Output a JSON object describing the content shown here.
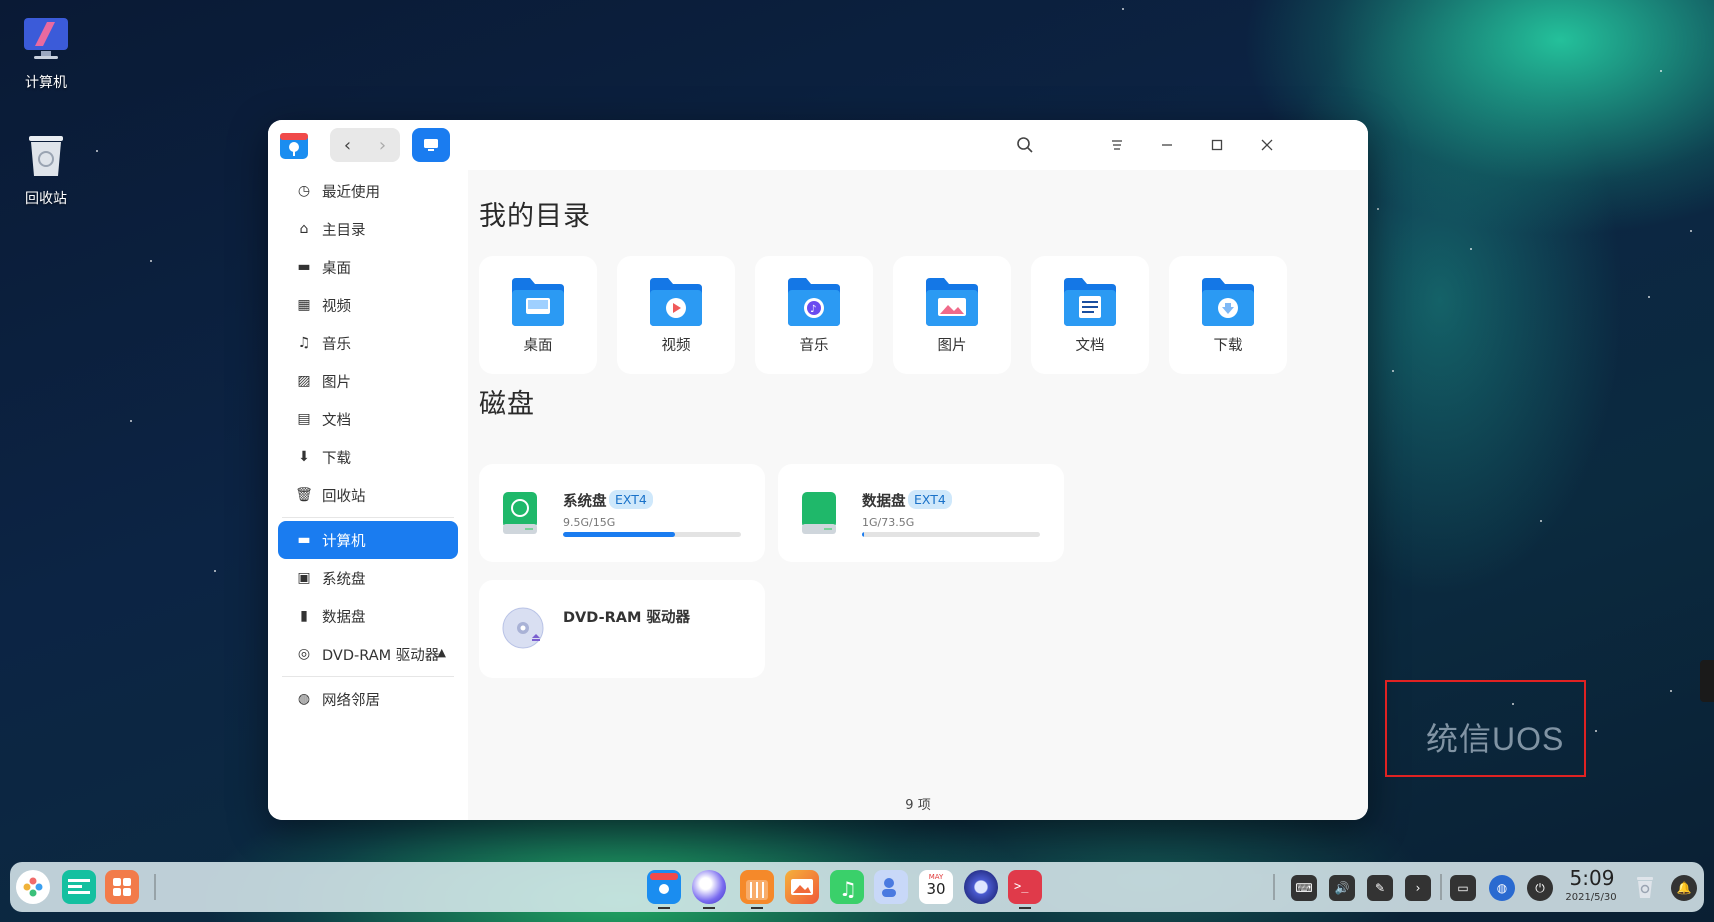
{
  "desktop": {
    "icons": [
      {
        "label": "计算机"
      },
      {
        "label": "回收站"
      }
    ]
  },
  "window": {
    "sidebar": {
      "items": [
        {
          "label": "最近使用",
          "icon": "clock-icon"
        },
        {
          "label": "主目录",
          "icon": "home-icon"
        },
        {
          "label": "桌面",
          "icon": "desktop-icon"
        },
        {
          "label": "视频",
          "icon": "video-icon"
        },
        {
          "label": "音乐",
          "icon": "music-icon"
        },
        {
          "label": "图片",
          "icon": "picture-icon"
        },
        {
          "label": "文档",
          "icon": "document-icon"
        },
        {
          "label": "下载",
          "icon": "download-icon"
        },
        {
          "label": "回收站",
          "icon": "trash-icon"
        },
        {
          "label": "计算机",
          "icon": "computer-icon",
          "active": true
        },
        {
          "label": "系统盘",
          "icon": "disk-icon"
        },
        {
          "label": "数据盘",
          "icon": "disk-icon"
        },
        {
          "label": "DVD-RAM 驱动器",
          "icon": "disc-icon"
        },
        {
          "label": "网络邻居",
          "icon": "network-icon"
        }
      ]
    },
    "content": {
      "my_dirs_title": "我的目录",
      "folders": [
        {
          "label": "桌面"
        },
        {
          "label": "视频"
        },
        {
          "label": "音乐"
        },
        {
          "label": "图片"
        },
        {
          "label": "文档"
        },
        {
          "label": "下载"
        }
      ],
      "disks_title": "磁盘",
      "disks": [
        {
          "name": "系统盘",
          "fs": "EXT4",
          "size": "9.5G/15G",
          "usage": 0.63,
          "color": "#1fb86a"
        },
        {
          "name": "数据盘",
          "fs": "EXT4",
          "size": "1G/73.5G",
          "usage": 0.014,
          "color": "#1fb86a"
        }
      ],
      "dvd": {
        "name": "DVD-RAM 驱动器"
      }
    },
    "status": "9 项",
    "accent": "#1a7cf0"
  },
  "watermark": {
    "text": "统信UOS"
  },
  "taskbar": {
    "clock_time": "5:09",
    "clock_date": "2021/5/30",
    "calendar_month": "MAY",
    "calendar_day": "30"
  }
}
